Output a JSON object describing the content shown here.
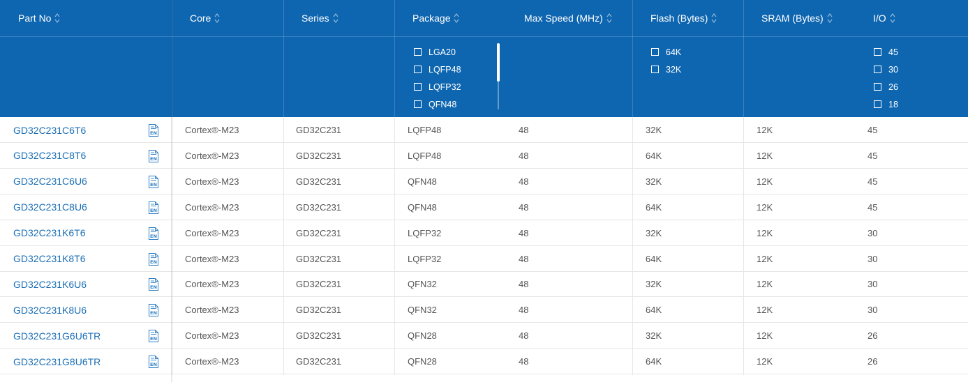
{
  "colors": {
    "header_bg": "#0f66b0",
    "link": "#1a6eb5",
    "text": "#555555"
  },
  "columns": [
    {
      "key": "part",
      "label": "Part No"
    },
    {
      "key": "core",
      "label": "Core"
    },
    {
      "key": "series",
      "label": "Series"
    },
    {
      "key": "package",
      "label": "Package"
    },
    {
      "key": "speed",
      "label": "Max Speed (MHz)"
    },
    {
      "key": "flash",
      "label": "Flash (Bytes)"
    },
    {
      "key": "sram",
      "label": "SRAM (Bytes)"
    },
    {
      "key": "io",
      "label": "I/O"
    }
  ],
  "filters": {
    "package": [
      "LGA20",
      "LQFP48",
      "LQFP32",
      "QFN48"
    ],
    "flash": [
      "64K",
      "32K"
    ],
    "io": [
      "45",
      "30",
      "26",
      "18"
    ]
  },
  "datasheet_icon": {
    "name": "en-datasheet-icon",
    "label": "EN"
  },
  "rows": [
    {
      "part": "GD32C231C6T6",
      "core": "Cortex®-M23",
      "series": "GD32C231",
      "package": "LQFP48",
      "speed": "48",
      "flash": "32K",
      "sram": "12K",
      "io": "45"
    },
    {
      "part": "GD32C231C8T6",
      "core": "Cortex®-M23",
      "series": "GD32C231",
      "package": "LQFP48",
      "speed": "48",
      "flash": "64K",
      "sram": "12K",
      "io": "45"
    },
    {
      "part": "GD32C231C6U6",
      "core": "Cortex®-M23",
      "series": "GD32C231",
      "package": "QFN48",
      "speed": "48",
      "flash": "32K",
      "sram": "12K",
      "io": "45"
    },
    {
      "part": "GD32C231C8U6",
      "core": "Cortex®-M23",
      "series": "GD32C231",
      "package": "QFN48",
      "speed": "48",
      "flash": "64K",
      "sram": "12K",
      "io": "45"
    },
    {
      "part": "GD32C231K6T6",
      "core": "Cortex®-M23",
      "series": "GD32C231",
      "package": "LQFP32",
      "speed": "48",
      "flash": "32K",
      "sram": "12K",
      "io": "30"
    },
    {
      "part": "GD32C231K8T6",
      "core": "Cortex®-M23",
      "series": "GD32C231",
      "package": "LQFP32",
      "speed": "48",
      "flash": "64K",
      "sram": "12K",
      "io": "30"
    },
    {
      "part": "GD32C231K6U6",
      "core": "Cortex®-M23",
      "series": "GD32C231",
      "package": "QFN32",
      "speed": "48",
      "flash": "32K",
      "sram": "12K",
      "io": "30"
    },
    {
      "part": "GD32C231K8U6",
      "core": "Cortex®-M23",
      "series": "GD32C231",
      "package": "QFN32",
      "speed": "48",
      "flash": "64K",
      "sram": "12K",
      "io": "30"
    },
    {
      "part": "GD32C231G6U6TR",
      "core": "Cortex®-M23",
      "series": "GD32C231",
      "package": "QFN28",
      "speed": "48",
      "flash": "32K",
      "sram": "12K",
      "io": "26"
    },
    {
      "part": "GD32C231G8U6TR",
      "core": "Cortex®-M23",
      "series": "GD32C231",
      "package": "QFN28",
      "speed": "48",
      "flash": "64K",
      "sram": "12K",
      "io": "26"
    }
  ]
}
